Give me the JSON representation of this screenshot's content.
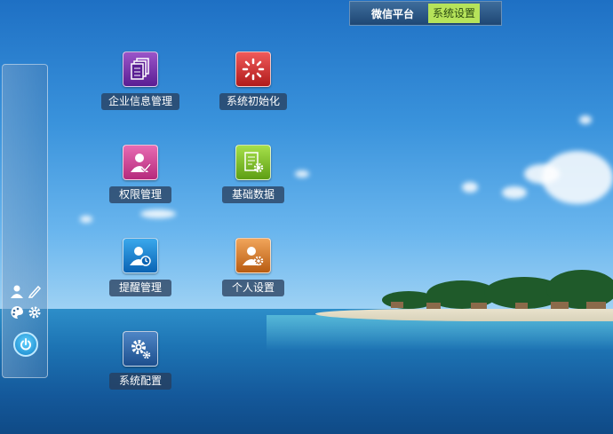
{
  "topbar": {
    "tabs": [
      {
        "label": "微信平台"
      },
      {
        "label": "系统设置",
        "active": true
      }
    ],
    "active_color": "#b6e35a"
  },
  "desktop": {
    "apps": [
      {
        "label": "企业信息管理",
        "icon": "documents-icon",
        "color": "#7a3bb0"
      },
      {
        "label": "系统初始化",
        "icon": "reset-burst-icon",
        "color": "#d03030"
      },
      {
        "label": "权限管理",
        "icon": "user-check-icon",
        "color": "#cc4898"
      },
      {
        "label": "基础数据",
        "icon": "document-gear-icon",
        "color": "#7fbf2a"
      },
      {
        "label": "提醒管理",
        "icon": "user-clock-icon",
        "color": "#1a86d0"
      },
      {
        "label": "个人设置",
        "icon": "user-gear-icon",
        "color": "#d57e30"
      },
      {
        "label": "系统配置",
        "icon": "gears-icon",
        "color": "#2d66a8"
      }
    ]
  },
  "dock": {
    "icons": [
      "user-icon",
      "pencil-icon",
      "palette-icon",
      "gear-icon",
      "power-icon"
    ]
  }
}
